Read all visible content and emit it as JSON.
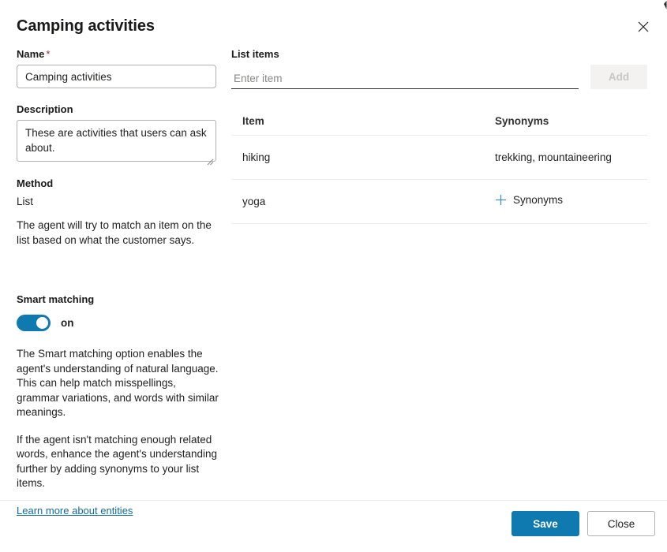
{
  "dialog": {
    "title": "Camping activities",
    "close_icon": "close-icon"
  },
  "form": {
    "name": {
      "label": "Name",
      "required_marker": "*",
      "value": "Camping activities",
      "placeholder": ""
    },
    "description": {
      "label": "Description",
      "value": "These are activities that users can ask about.",
      "placeholder": ""
    },
    "method": {
      "label": "Method",
      "value": "List",
      "help_text": "The agent will try to match an item on the list based on what the customer says."
    }
  },
  "smart_matching": {
    "label": "Smart matching",
    "toggle_state_label": "on",
    "toggle_on": true,
    "toggle_color": "#0f7ab0",
    "paragraphs": [
      "The Smart matching option enables the agent's understanding of natural language. This can help match misspellings, grammar variations, and words with similar meanings.",
      "If the agent isn't matching enough related words, enhance the agent's understanding further by adding synonyms to your list items."
    ],
    "link": {
      "text": "Learn more about entities",
      "color": "#0f6c9e"
    }
  },
  "list_items": {
    "label": "List items",
    "input_value": "",
    "input_placeholder": "Enter item",
    "add_button": {
      "label": "Add",
      "disabled": true
    },
    "table": {
      "columns": [
        "Item",
        "Synonyms"
      ],
      "rows": [
        {
          "item": "hiking",
          "synonyms": "trekking, mountaineering",
          "has_add_link": false
        },
        {
          "item": "yoga",
          "synonyms": "",
          "has_add_link": true,
          "add_link_label": "Synonyms"
        }
      ]
    }
  },
  "footer": {
    "save_label": "Save",
    "close_label": "Close",
    "primary_color": "#0f7ab0"
  }
}
